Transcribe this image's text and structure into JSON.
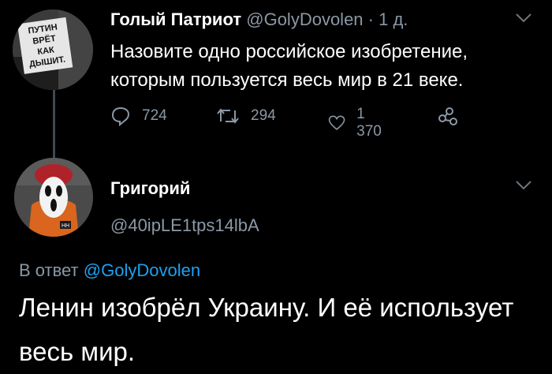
{
  "tweet": {
    "author_name": "Голый Патриот",
    "handle": "@GolyDovolen",
    "separator": "·",
    "time": "1 д.",
    "text": "Назовите одно российское изобретение, которым пользуется весь мир в 21 веке.",
    "avatar_sign": [
      "ПУТИН",
      "ВРЁТ",
      "КАК",
      "ДЫШИТ."
    ],
    "stats": {
      "replies": "724",
      "retweets": "294",
      "likes": "1 370"
    }
  },
  "reply": {
    "author_name": "Григорий",
    "handle": "@40ipLE1tps14lbA",
    "reply_to_label": "В ответ",
    "reply_to_mention": "@GolyDovolen",
    "text": "Ленин изобрёл Украину. И её использует весь мир.",
    "avatar_badge": "НН"
  },
  "colors": {
    "background": "#000000",
    "secondary_text": "#8b98a5",
    "link": "#1da1f2"
  },
  "icons": [
    "reply-icon",
    "retweet-icon",
    "like-icon",
    "share-icon",
    "chevron-down-icon"
  ]
}
